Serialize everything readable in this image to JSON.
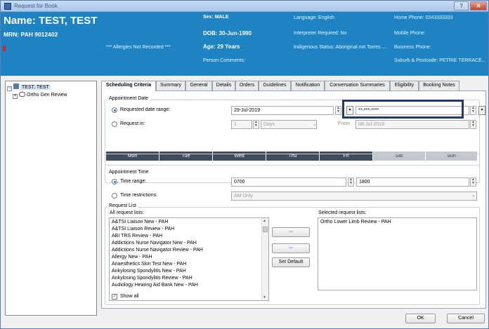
{
  "window": {
    "title": "Request for Book",
    "help_label": "?",
    "close_label": "✕"
  },
  "patient": {
    "name": "Name: TEST, TEST",
    "mrn": "MRN: PAH 9012402",
    "sex": "Sex: MALE",
    "dob": "DOB: 30-Jun-1990",
    "age": "Age: 29 Years",
    "allergies": "*** Allergies Not Recorded ***",
    "person_comments": "Person Comments:",
    "language": "Language: English",
    "interpreter": "Interpreter Required: No",
    "indigenous": "Indigenous Status: Aboriginal not Torres ...",
    "home_phone": "Home Phone: 0243333333",
    "mobile_phone": "Mobile Phone:",
    "business_phone": "Business Phone:",
    "suburb": "Suburb & Postcode: PETRIE TERRACE..."
  },
  "tree": {
    "root_label": "TEST, TEST",
    "child_label": "Ortho Gen Review"
  },
  "tabs": [
    {
      "label": "Scheduling Criteria",
      "active": true
    },
    {
      "label": "Summary"
    },
    {
      "label": "General"
    },
    {
      "label": "Details"
    },
    {
      "label": "Orders"
    },
    {
      "label": "Guidelines"
    },
    {
      "label": "Notification"
    },
    {
      "label": "Conversation Summaries"
    },
    {
      "label": "Eligibility"
    },
    {
      "label": "Booking Notes"
    }
  ],
  "appointment_date": {
    "group_label": "Appointment Date",
    "requested_range_label": "Requested date range:",
    "start_date": "29-Jul-2019",
    "end_date": "**-***-****",
    "request_in_label": "Request in:",
    "request_in_value": "1",
    "request_in_unit": "Days",
    "from_label": "From:",
    "from_value": "08-Jul-2019",
    "selected_option": "requested_date_range"
  },
  "days": [
    {
      "label": "Mon",
      "selected": true
    },
    {
      "label": "Tue",
      "selected": true
    },
    {
      "label": "Wed",
      "selected": true
    },
    {
      "label": "Thu",
      "selected": true
    },
    {
      "label": "Fri",
      "selected": true
    },
    {
      "label": "Sat",
      "selected": false
    },
    {
      "label": "Sun",
      "selected": false
    }
  ],
  "appointment_time": {
    "group_label": "Appointment Time",
    "time_range_label": "Time range:",
    "time_from": "0700",
    "time_to": "1800",
    "time_restrictions_label": "Time restrictions:",
    "time_restrictions_value": "AM Only",
    "selected_option": "time_range"
  },
  "request_list": {
    "group_label": "Request List",
    "all_label": "All request lists:",
    "selected_label": "Selected request lists:",
    "all_items": [
      "A&TSI Liaison New - PAH",
      "A&TSI Liaison Review - PAH",
      "ABI TRS Review - PAH",
      "Addictions Nurse Navigator New - PAH",
      "Addictions Nurse Navigator Review - PAH",
      "Allergy New - PAH",
      "Anaesthetics Skin Test New - PAH",
      "Ankylosing Spondylitis New - PAH",
      "Ankylosing Spondylitis Review - PAH",
      "Audiology Hearing Aid Bank New - PAH"
    ],
    "selected_items": [
      "Ortho Lower Limb Review - PAH"
    ],
    "add_label": "⇨",
    "remove_label": "⇦",
    "set_default_label": "Set Default",
    "show_all_label": "Show all",
    "show_all_checked": true
  },
  "footer": {
    "ok_label": "OK",
    "cancel_label": "Cancel"
  },
  "colors": {
    "banner": "#1d83c3",
    "day_selected": "#3e4c5e",
    "day_unselected": "#c2c6cd",
    "highlight": "#1f3a6e"
  }
}
